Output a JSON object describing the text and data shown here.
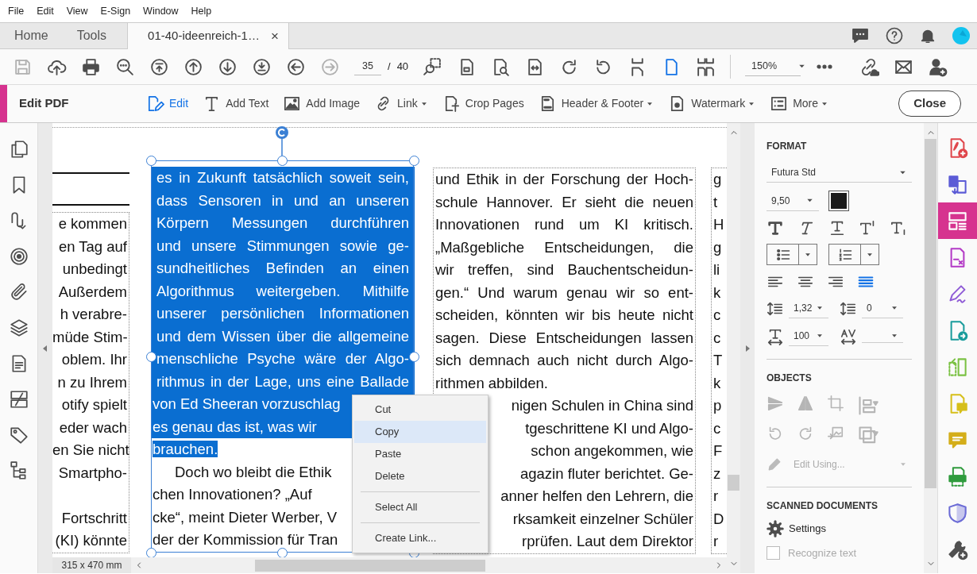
{
  "menu_bar": [
    "File",
    "Edit",
    "View",
    "E-Sign",
    "Window",
    "Help"
  ],
  "tabs": [
    {
      "label": "Home",
      "selected": false
    },
    {
      "label": "Tools",
      "selected": false
    },
    {
      "label": "01-40-ideenreich-1…",
      "selected": true
    }
  ],
  "tab_close": "×",
  "toolbar": {
    "nav_buttons": [
      {
        "disabled": true
      },
      {
        "disabled": false
      },
      {
        "disabled": false
      },
      {
        "disabled": false
      },
      {
        "disabled": false
      },
      {
        "disabled": false
      },
      {
        "disabled": false
      },
      {
        "disabled": false
      },
      {
        "disabled": false
      },
      {
        "disabled": true
      }
    ],
    "page_field": "35",
    "page_separator": "/",
    "page_total": "40",
    "view_buttons": [
      {
        "selected": false
      },
      {
        "selected": false
      },
      {
        "selected": false
      },
      {
        "selected": false
      },
      {
        "selected": false
      },
      {
        "selected": false
      },
      {
        "selected": false
      },
      {
        "selected": true
      },
      {
        "selected": false
      }
    ],
    "zoom": "150%"
  },
  "edit_bar": {
    "title": "Edit PDF",
    "tools": [
      {
        "label": "Edit",
        "selected": true,
        "dropdown": false
      },
      {
        "label": "Add Text",
        "selected": false,
        "dropdown": false
      },
      {
        "label": "Add Image",
        "selected": false,
        "dropdown": false
      },
      {
        "label": "Link",
        "selected": false,
        "dropdown": true
      },
      {
        "label": "Crop Pages",
        "selected": false,
        "dropdown": false
      },
      {
        "label": "Header & Footer",
        "selected": false,
        "dropdown": true
      },
      {
        "label": "Watermark",
        "selected": false,
        "dropdown": true
      },
      {
        "label": "More",
        "selected": false,
        "dropdown": true
      }
    ],
    "close": "Close"
  },
  "document": {
    "columns": [
      {
        "paragraphs": [
          {
            "space_before": false,
            "lines": [
              {
                "text": "e kommen",
                "kind": "right"
              },
              {
                "text": "en Tag auf",
                "kind": "right"
              },
              {
                "text": "unbedingt",
                "kind": "right"
              },
              {
                "text": "Außerdem",
                "kind": "right"
              },
              {
                "text": "h verabre-",
                "kind": "right"
              },
              {
                "text": "müde Stim-",
                "kind": "right"
              },
              {
                "text": "oblem. Ihr",
                "kind": "right"
              },
              {
                "text": "n zu Ihrem",
                "kind": "right"
              },
              {
                "text": "otify spielt",
                "kind": "right"
              },
              {
                "text": "eder wach",
                "kind": "right"
              },
              {
                "text": "en Sie nicht",
                "kind": "right"
              },
              {
                "text": "Smartpho-",
                "kind": "right"
              }
            ]
          },
          {
            "space_before": true,
            "lines": [
              {
                "text": "Fortschritt",
                "kind": "right"
              },
              {
                "text": "(KI) könnte",
                "kind": "right"
              }
            ]
          }
        ]
      },
      {
        "paragraphs": [
          {
            "space_before": false,
            "lines": [
              {
                "text": "es in Zukunft tatsächlich soweit sein,",
                "kind": "justify",
                "selected": true
              },
              {
                "text": "dass Sensoren in und an unseren",
                "kind": "justify",
                "selected": true
              },
              {
                "text": "Körpern Messungen durchführen",
                "kind": "justify",
                "selected": true
              },
              {
                "text": "und unsere Stimmungen sowie ge-",
                "kind": "justify",
                "selected": true
              },
              {
                "text": "sundheitliches Befinden an einen",
                "kind": "justify",
                "selected": true
              },
              {
                "text": "Algorithmus weitergeben. Mithilfe",
                "kind": "justify",
                "selected": true
              },
              {
                "text": "unserer persönlichen Informationen",
                "kind": "justify",
                "selected": true
              },
              {
                "text": "und dem Wissen über die allgemeine",
                "kind": "justify",
                "selected": true
              },
              {
                "text": "menschliche Psyche wäre der Algo-",
                "kind": "justify",
                "selected": true
              },
              {
                "text": "rithmus in der Lage, uns eine Ballade",
                "kind": "justify",
                "selected": true
              },
              {
                "text": "von Ed Sheeran vorzuschlag",
                "kind": "left",
                "selected": true
              },
              {
                "text": "es genau das ist, was wir",
                "kind": "left",
                "selected": true
              },
              {
                "text": "brauchen.",
                "kind": "end",
                "selected": true
              }
            ]
          },
          {
            "space_before": false,
            "lines": [
              {
                "text": "Doch wo bleibt die Ethik",
                "kind": "indent",
                "selected": false
              },
              {
                "text": "chen Innovationen? „Auf",
                "kind": "left",
                "selected": false
              },
              {
                "text": "cke“, meint Dieter Werber, V",
                "kind": "left",
                "selected": false
              },
              {
                "text": "der der Kommission für Tran",
                "kind": "left",
                "selected": false
              }
            ]
          }
        ]
      },
      {
        "paragraphs": [
          {
            "space_before": false,
            "lines": [
              {
                "text": "und Ethik in der Forschung der Hoch-",
                "kind": "justify"
              },
              {
                "text": "schule Hannover. Er sieht die neuen",
                "kind": "justify"
              },
              {
                "text": "Innovationen rund um KI kritisch.",
                "kind": "justify"
              },
              {
                "text": "„Maßgebliche Entscheidungen, die",
                "kind": "justify"
              },
              {
                "text": "wir treffen, sind Bauchentscheidun-",
                "kind": "justify"
              },
              {
                "text": "gen.“ Und warum genau wir so ent-",
                "kind": "justify"
              },
              {
                "text": "scheiden, könnten wir bis heute nicht",
                "kind": "justify"
              },
              {
                "text": "sagen. Diese Entscheidungen lassen",
                "kind": "justify"
              },
              {
                "text": "sich demnach auch nicht durch Algo-",
                "kind": "justify"
              },
              {
                "text": "rithmen abbilden.",
                "kind": "left"
              }
            ]
          },
          {
            "space_before": false,
            "lines": [
              {
                "text": "nigen Schulen in China sind",
                "kind": "right"
              },
              {
                "text": "tgeschrittene KI und Algo-",
                "kind": "right"
              },
              {
                "text": "schon angekommen, wie",
                "kind": "right"
              },
              {
                "text": "agazin fluter berichtet. Ge-",
                "kind": "right"
              },
              {
                "text": "anner helfen den Lehrern, die",
                "kind": "right"
              },
              {
                "text": "rksamkeit einzelner Schüler",
                "kind": "right"
              },
              {
                "text": "rprüfen. Laut dem Direktor",
                "kind": "right"
              }
            ]
          }
        ]
      },
      {
        "paragraphs": [
          {
            "space_before": false,
            "lines": [
              {
                "text": "g",
                "kind": "left"
              },
              {
                "text": "t",
                "kind": "left"
              },
              {
                "text": "H",
                "kind": "left"
              },
              {
                "text": "g",
                "kind": "left"
              },
              {
                "text": "li",
                "kind": "left"
              },
              {
                "text": "k",
                "kind": "left"
              },
              {
                "text": "c",
                "kind": "left"
              },
              {
                "text": "c",
                "kind": "left"
              },
              {
                "text": "T",
                "kind": "left"
              },
              {
                "text": "k",
                "kind": "left"
              },
              {
                "text": "p",
                "kind": "left"
              },
              {
                "text": "c",
                "kind": "left"
              },
              {
                "text": "F",
                "kind": "left"
              },
              {
                "text": "z",
                "kind": "left"
              },
              {
                "text": "r",
                "kind": "left"
              },
              {
                "text": "D",
                "kind": "left"
              },
              {
                "text": "r",
                "kind": "left"
              }
            ]
          }
        ]
      }
    ],
    "context_menu": [
      {
        "kind": "item",
        "label": "Cut",
        "selected": false
      },
      {
        "kind": "item",
        "label": "Copy",
        "selected": true
      },
      {
        "kind": "item",
        "label": "Paste",
        "selected": false
      },
      {
        "kind": "item",
        "label": "Delete",
        "selected": false
      },
      {
        "kind": "separator"
      },
      {
        "kind": "item",
        "label": "Select All",
        "selected": false
      },
      {
        "kind": "separator"
      },
      {
        "kind": "item",
        "label": "Create Link...",
        "selected": false
      }
    ],
    "page_size": "315 x 470 mm"
  },
  "format_panel": {
    "format_heading": "FORMAT",
    "font": "Futura Std",
    "font_size": "9,50",
    "color": "#1a1a1a",
    "alignment": [
      {
        "selected": false
      },
      {
        "selected": false
      },
      {
        "selected": false
      },
      {
        "selected": true
      }
    ],
    "line_spacing": "1,32",
    "paragraph_spacing": "0",
    "horizontal_scale": "100",
    "objects_heading": "OBJECTS",
    "object_tools": [
      {
        "disabled": true
      },
      {
        "disabled": true
      },
      {
        "disabled": true
      },
      {
        "disabled": true
      },
      {
        "disabled": true
      },
      {
        "disabled": true
      },
      {
        "disabled": true
      },
      {
        "disabled": true
      }
    ],
    "edit_using": {
      "label": "Edit Using...",
      "disabled": true
    },
    "scanned_heading": "SCANNED DOCUMENTS",
    "settings": "Settings",
    "recognize_text": {
      "label": "Recognize text",
      "checked": false,
      "disabled": true
    }
  },
  "right_rail": [
    {
      "selected": false
    },
    {
      "selected": false
    },
    {
      "selected": true
    },
    {
      "selected": false
    },
    {
      "selected": false
    },
    {
      "selected": false
    },
    {
      "selected": false
    },
    {
      "selected": false
    },
    {
      "selected": false
    },
    {
      "selected": false
    },
    {
      "selected": false
    },
    {
      "selected": false
    }
  ]
}
